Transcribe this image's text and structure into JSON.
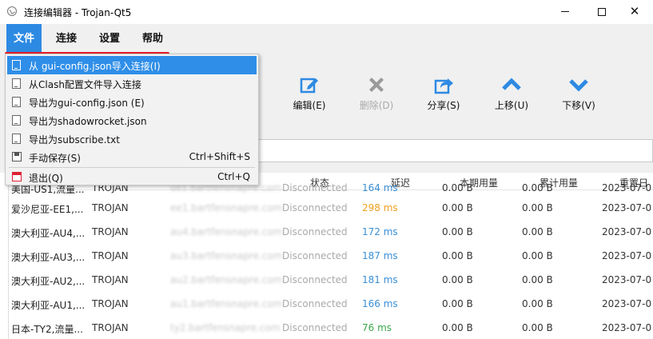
{
  "window": {
    "title": "连接编辑器 - Trojan-Qt5"
  },
  "menubar": {
    "items": [
      "文件",
      "连接",
      "设置",
      "帮助"
    ]
  },
  "toolbar": {
    "edit": "编辑(E)",
    "delete": "删除(D)",
    "share": "分享(S)",
    "move_up": "上移(U)",
    "move_down": "下移(V)"
  },
  "colors": {
    "accent": "#2d8ae3",
    "highlight_box": "#e2202a",
    "latency_orange": "#f0a020",
    "latency_blue": "#3a8fd6",
    "latency_green": "#3aa84a",
    "disabled_text": "#aaaaaa"
  },
  "file_menu": {
    "items": [
      {
        "label": "从 gui-config.json导入连接(I)",
        "shortcut": "",
        "icon": "document-icon"
      },
      {
        "label": "从Clash配置文件导入连接",
        "shortcut": "",
        "icon": "document-icon"
      },
      {
        "label": "导出为gui-config.json (E)",
        "shortcut": "",
        "icon": "document-icon"
      },
      {
        "label": "导出为shadowrocket.json",
        "shortcut": "",
        "icon": "document-icon"
      },
      {
        "label": "导出为subscribe.txt",
        "shortcut": "",
        "icon": "document-icon"
      },
      {
        "label": "手动保存(S)",
        "shortcut": "Ctrl+Shift+S",
        "icon": "save-icon"
      },
      {
        "label": "退出(Q)",
        "shortcut": "Ctrl+Q",
        "icon": "exit-icon"
      }
    ]
  },
  "table": {
    "headers": {
      "status": "状态",
      "latency": "延迟",
      "period_usage": "本期用量",
      "total_usage": "累计用量",
      "reset_date": "重置日"
    },
    "rows": [
      {
        "name": "美国-US1,流量...",
        "protocol": "TROJAN",
        "address": "us1.bartfensnapre.com",
        "status": "Disconnected",
        "latency": "164 ms",
        "period": "0.00  B",
        "total": "0.00  B",
        "reset": "2023-07-0",
        "lat_color": "#3a8fd6"
      },
      {
        "name": "爱沙尼亚-EE1,...",
        "protocol": "TROJAN",
        "address": "ee1.bartfensnapre.com",
        "status": "Disconnected",
        "latency": "298 ms",
        "period": "0.00  B",
        "total": "0.00  B",
        "reset": "2023-07-0",
        "lat_color": "#f0a020"
      },
      {
        "name": "澳大利亚-AU4,...",
        "protocol": "TROJAN",
        "address": "au4.bartfensnapre.com",
        "status": "Disconnected",
        "latency": "172 ms",
        "period": "0.00  B",
        "total": "0.00  B",
        "reset": "2023-07-0",
        "lat_color": "#3a8fd6"
      },
      {
        "name": "澳大利亚-AU3,...",
        "protocol": "TROJAN",
        "address": "au3.bartfensnapre.com",
        "status": "Disconnected",
        "latency": "187 ms",
        "period": "0.00  B",
        "total": "0.00  B",
        "reset": "2023-07-0",
        "lat_color": "#3a8fd6"
      },
      {
        "name": "澳大利亚-AU2,...",
        "protocol": "TROJAN",
        "address": "au2.bartfensnapre.com",
        "status": "Disconnected",
        "latency": "181 ms",
        "period": "0.00  B",
        "total": "0.00  B",
        "reset": "2023-07-0",
        "lat_color": "#3a8fd6"
      },
      {
        "name": "澳大利亚-AU1,...",
        "protocol": "TROJAN",
        "address": "au1.bartfensnapre.com",
        "status": "Disconnected",
        "latency": "166 ms",
        "period": "0.00  B",
        "total": "0.00  B",
        "reset": "2023-07-0",
        "lat_color": "#3a8fd6"
      },
      {
        "name": "日本-TY2,流量...",
        "protocol": "TROJAN",
        "address": "ty2.bartfensnapre.com",
        "status": "Disconnected",
        "latency": "76 ms",
        "period": "0.00  B",
        "total": "0.00  B",
        "reset": "2023-07-0",
        "lat_color": "#3aa84a"
      }
    ]
  }
}
